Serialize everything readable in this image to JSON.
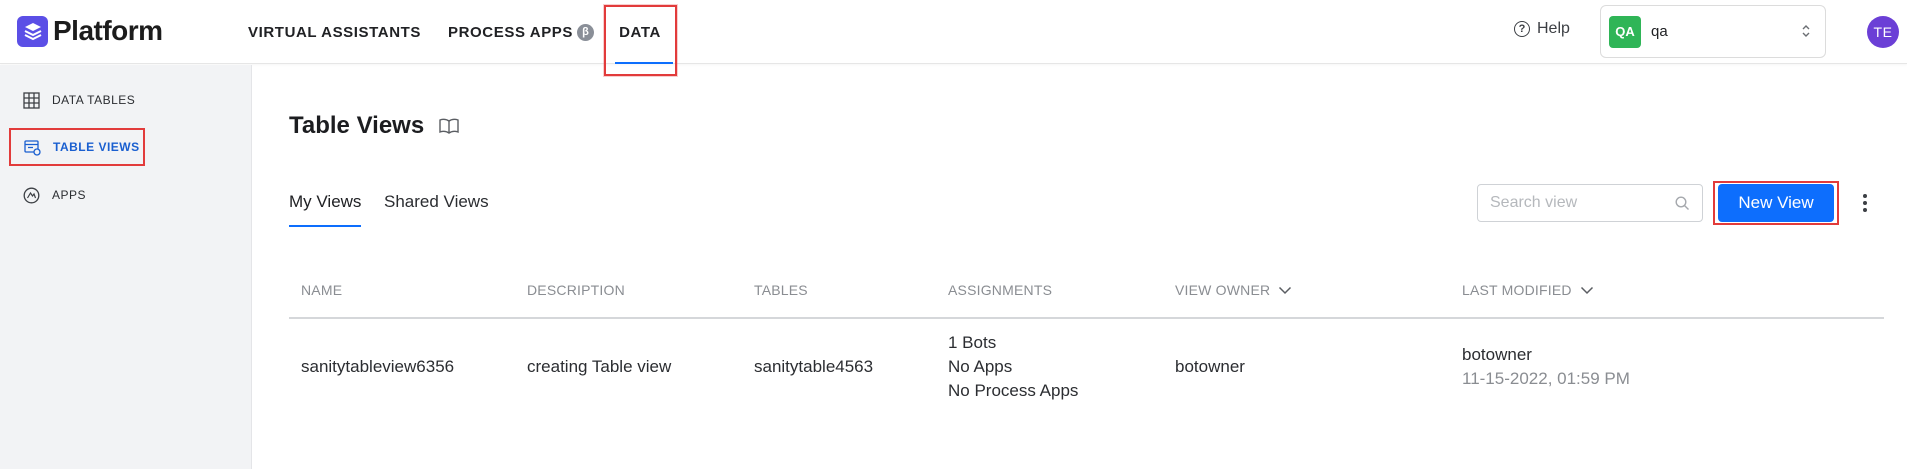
{
  "header": {
    "logo_text": "Platform",
    "nav": [
      {
        "label": "VIRTUAL ASSISTANTS"
      },
      {
        "label": "PROCESS APPS",
        "badge": "β"
      },
      {
        "label": "DATA",
        "active": true
      }
    ],
    "help_label": "Help",
    "account": {
      "badge": "QA",
      "name": "qa",
      "badge_color": "#2fb557"
    },
    "avatar_initials": "TE",
    "avatar_color": "#6b3fd6"
  },
  "sidebar": {
    "items": [
      {
        "label": "DATA TABLES",
        "icon": "grid-icon"
      },
      {
        "label": "TABLE VIEWS",
        "icon": "table-view-icon",
        "active": true
      },
      {
        "label": "APPS",
        "icon": "apps-icon"
      }
    ]
  },
  "main": {
    "title": "Table Views",
    "tabs": [
      {
        "label": "My Views",
        "active": true
      },
      {
        "label": "Shared Views"
      }
    ],
    "search_placeholder": "Search view",
    "new_view_label": "New View",
    "accent_color": "#0d6efd",
    "table": {
      "columns": [
        "NAME",
        "DESCRIPTION",
        "TABLES",
        "ASSIGNMENTS",
        "VIEW OWNER",
        "LAST MODIFIED"
      ],
      "rows": [
        {
          "name": "sanitytableview6356",
          "description": "creating Table view",
          "tables": "sanitytable4563",
          "assignments": [
            "1 Bots",
            "No Apps",
            "No Process Apps"
          ],
          "view_owner": "botowner",
          "last_modified_by": "botowner",
          "last_modified_at": "11-15-2022, 01:59 PM"
        }
      ]
    }
  }
}
